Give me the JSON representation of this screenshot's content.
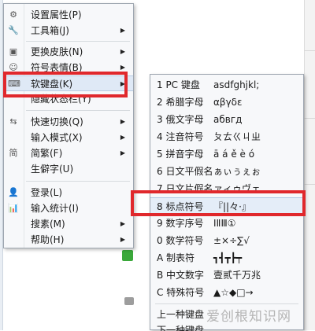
{
  "menu": {
    "items": [
      {
        "label": "设置属性(P)",
        "icon": "gear-icon",
        "glyph": "⚙",
        "arrow": false
      },
      {
        "label": "工具箱(J)",
        "icon": "wrench-icon",
        "glyph": "🔧",
        "arrow": true
      },
      {
        "label": "更换皮肤(N)",
        "icon": "skin-icon",
        "glyph": "▣",
        "arrow": true
      },
      {
        "label": "符号表情(B)",
        "icon": "emoji-icon",
        "glyph": "☺",
        "arrow": true
      },
      {
        "label": "软键盘(K)",
        "icon": "keyboard-icon",
        "glyph": "⌨",
        "arrow": true
      },
      {
        "label": "隐藏状态栏(Y)",
        "icon": "",
        "glyph": "",
        "arrow": false
      },
      {
        "label": "快速切换(Q)",
        "icon": "switch-icon",
        "glyph": "⇆",
        "arrow": true
      },
      {
        "label": "输入模式(X)",
        "icon": "",
        "glyph": "",
        "arrow": true
      },
      {
        "label": "简繁(F)",
        "icon": "simplified-icon",
        "glyph": "简",
        "arrow": true
      },
      {
        "label": "生僻字(U)",
        "icon": "",
        "glyph": "",
        "arrow": false
      },
      {
        "label": "登录(L)",
        "icon": "user-icon",
        "glyph": "👤",
        "arrow": false
      },
      {
        "label": "输入统计(I)",
        "icon": "stats-icon",
        "glyph": "📊",
        "arrow": false
      },
      {
        "label": "搜素(M)",
        "icon": "",
        "glyph": "",
        "arrow": true
      },
      {
        "label": "帮助(H)",
        "icon": "",
        "glyph": "",
        "arrow": true
      }
    ],
    "arrow_glyph": "▶"
  },
  "submenu": {
    "items": [
      {
        "label": "1 PC 键盘",
        "sample": "asdfghjkl;"
      },
      {
        "label": "2 希腊字母",
        "sample": "αβγδε"
      },
      {
        "label": "3 俄文字母",
        "sample": "абвгд"
      },
      {
        "label": "4 注音符号",
        "sample": "ㄆㄊㄍㄐㄓ"
      },
      {
        "label": "5 拼音字母",
        "sample": "ā á ě è ó"
      },
      {
        "label": "6 日文平假名",
        "sample": "ぁぃぅぇぉ"
      },
      {
        "label": "7 日文片假名",
        "sample": "ァィゥヴェ"
      },
      {
        "label": "8 标点符号",
        "sample": "『||々·』"
      },
      {
        "label": "9 数字序号",
        "sample": "ⅠⅡⅢ①"
      },
      {
        "label": "0 数学符号",
        "sample": "±×÷∑√"
      },
      {
        "label": "A 制表符",
        "sample": "┓┫┳┣┯"
      },
      {
        "label": "B 中文数字",
        "sample": "壹贰千万兆"
      },
      {
        "label": "C 特殊符号",
        "sample": "▲☆◆□→"
      },
      {
        "label": "上一种键盘",
        "sample": ""
      },
      {
        "label": "下一种键盘",
        "sample": ""
      }
    ]
  },
  "watermark": "爱创根知识网",
  "colors": {
    "highlight_box": "#e0282c",
    "menu_bg": "#f7f8fa",
    "hover_bg": "#dfe9f6"
  }
}
